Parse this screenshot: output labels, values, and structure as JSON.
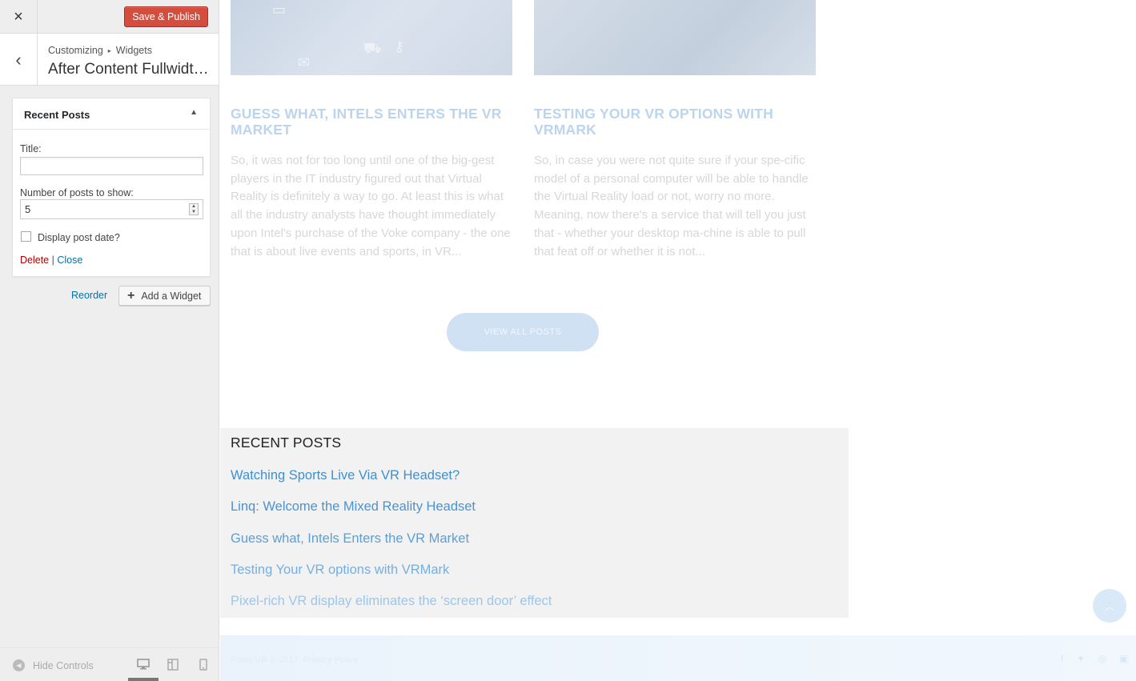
{
  "toolbar": {
    "close_icon": "×",
    "save_label": "Save & Publish"
  },
  "section": {
    "back_icon": "‹",
    "breadcrumb_root": "Customizing",
    "breadcrumb_sep": "▸",
    "breadcrumb_child": "Widgets",
    "title": "After Content Fullwidth ..."
  },
  "widget": {
    "name": "Recent Posts",
    "toggle_icon": "▲",
    "title_label": "Title:",
    "title_value": "",
    "num_label": "Number of posts to show:",
    "num_value": "5",
    "date_label": "Display post date?",
    "date_checked": false,
    "delete_label": "Delete",
    "action_sep": "|",
    "close_label": "Close"
  },
  "widget_area": {
    "reorder_label": "Reorder",
    "add_label": "Add a Widget"
  },
  "footer_controls": {
    "hide_label": "Hide Controls"
  },
  "preview": {
    "posts": [
      {
        "title": "GUESS WHAT, INTELS ENTERS THE VR MARKET",
        "excerpt": "So, it was not for too long until one of the big-gest players in the IT industry figured out that Virtual Reality is definitely a way to go. At least this is what all the industry analysts have thought immediately upon Intel's purchase of the Voke company - the one that is about live events and sports, in VR..."
      },
      {
        "title": "TESTING YOUR VR OPTIONS WITH VRMARK",
        "excerpt": "So, in case you were not quite sure if your spe-cific model of a personal computer will be able to handle the Virtual Reality load or not, worry no more. Meaning, now there's a service that will tell you just that - whether your desktop ma-chine is able to pull that feat off or whether it is not..."
      }
    ],
    "view_all_label": "VIEW ALL POSTS",
    "recent_title": "RECENT POSTS",
    "recent_links": [
      "Watching Sports Live Via VR Headset?",
      "Linq: Welcome the Mixed Reality Headset",
      "Guess what, Intels Enters the VR Market",
      "Testing Your VR options with VRMark",
      "Pixel-rich VR display eliminates the ‘screen door’ effect"
    ],
    "copyright": "Pulse VR © 2017. Privacy Policy"
  },
  "colors": {
    "save_button": "#d54e3d",
    "link": "#0073aa",
    "delete": "#aa0000",
    "post_title": "#bcd4ee"
  },
  "icons": {
    "close": "close-icon",
    "back": "chevron-left-icon",
    "collapse": "triangle-up-icon",
    "add": "plus-icon",
    "hide": "arrow-left-circle-icon",
    "desktop": "desktop-icon",
    "tablet": "tablet-icon",
    "mobile": "mobile-icon",
    "scroll_top": "chevron-up-icon",
    "social": [
      "facebook-icon",
      "twitter-icon",
      "pinterest-icon",
      "youtube-icon"
    ]
  }
}
